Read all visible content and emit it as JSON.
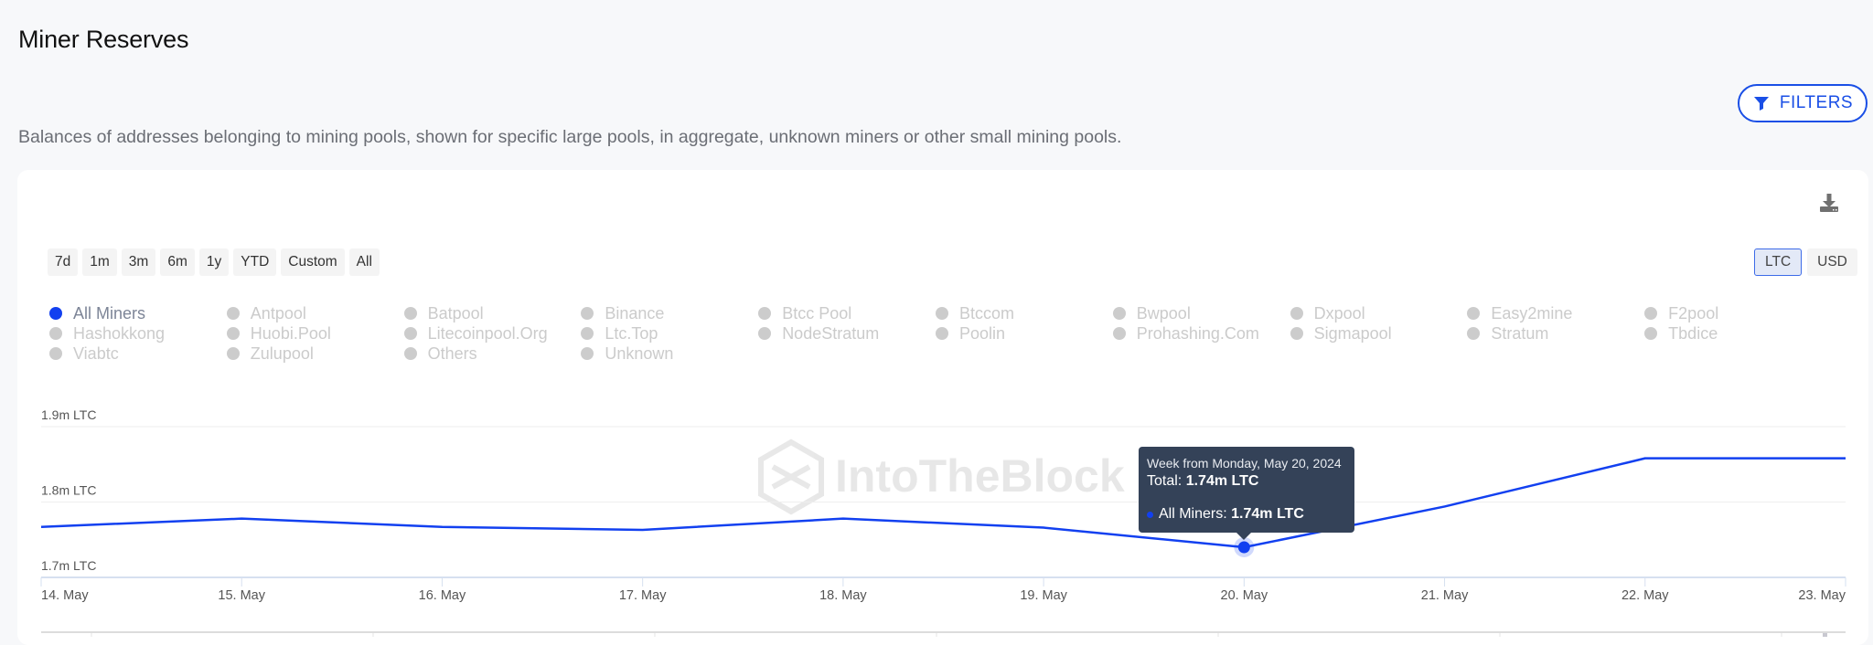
{
  "header": {
    "title": "Miner Reserves",
    "filters_label": "FILTERS",
    "description": "Balances of addresses belonging to mining pools, shown for specific large pools, in aggregate, unknown miners or other small mining pools."
  },
  "controls": {
    "ranges": [
      "7d",
      "1m",
      "3m",
      "6m",
      "1y",
      "YTD",
      "Custom",
      "All"
    ],
    "units": [
      {
        "label": "LTC",
        "active": true
      },
      {
        "label": "USD",
        "active": false
      }
    ],
    "download_icon": "download-icon"
  },
  "legend": [
    {
      "label": "All Miners",
      "active": true
    },
    {
      "label": "Antpool",
      "active": false
    },
    {
      "label": "Batpool",
      "active": false
    },
    {
      "label": "Binance",
      "active": false
    },
    {
      "label": "Btcc Pool",
      "active": false
    },
    {
      "label": "Btccom",
      "active": false
    },
    {
      "label": "Bwpool",
      "active": false
    },
    {
      "label": "Dxpool",
      "active": false
    },
    {
      "label": "Easy2mine",
      "active": false
    },
    {
      "label": "F2pool",
      "active": false
    },
    {
      "label": "Hashokkong",
      "active": false
    },
    {
      "label": "Huobi.Pool",
      "active": false
    },
    {
      "label": "Litecoinpool.Org",
      "active": false
    },
    {
      "label": "Ltc.Top",
      "active": false
    },
    {
      "label": "NodeStratum",
      "active": false
    },
    {
      "label": "Poolin",
      "active": false
    },
    {
      "label": "Prohashing.Com",
      "active": false
    },
    {
      "label": "Sigmapool",
      "active": false
    },
    {
      "label": "Stratum",
      "active": false
    },
    {
      "label": "Tbdice",
      "active": false
    },
    {
      "label": "Viabtc",
      "active": false
    },
    {
      "label": "Zulupool",
      "active": false
    },
    {
      "label": "Others",
      "active": false
    },
    {
      "label": "Unknown",
      "active": false
    }
  ],
  "watermark": "IntoTheBlock",
  "tooltip": {
    "date": "Week from Monday, May 20, 2024",
    "total_label": "Total:",
    "total_value": "1.74m LTC",
    "series_label": "All Miners:",
    "series_value": "1.74m LTC"
  },
  "colors": {
    "accent": "#1a4fe6",
    "series": "#1240f0",
    "inactive_legend": "#cccccc",
    "tooltip_bg": "#344258"
  },
  "chart_data": {
    "type": "line",
    "title": "Miner Reserves",
    "xlabel": "",
    "ylabel": "",
    "x": [
      "14. May",
      "15. May",
      "16. May",
      "17. May",
      "18. May",
      "19. May",
      "20. May",
      "21. May",
      "22. May",
      "23. May"
    ],
    "series": [
      {
        "name": "All Miners",
        "unit": "m LTC",
        "values": [
          1.767,
          1.778,
          1.767,
          1.763,
          1.778,
          1.766,
          1.74,
          1.794,
          1.858,
          1.858
        ]
      }
    ],
    "yticks": [
      1.7,
      1.8,
      1.9
    ],
    "ytick_labels": [
      "1.7m LTC",
      "1.8m LTC",
      "1.9m LTC"
    ],
    "ylim": [
      1.7,
      1.9
    ],
    "grid": true,
    "legend_position": "top",
    "highlighted_point": {
      "x": "20. May",
      "value": 1.74
    }
  }
}
